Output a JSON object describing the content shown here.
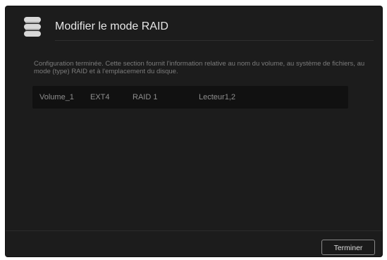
{
  "dialog": {
    "title": "Modifier le mode RAID",
    "title_icon": "database-icon",
    "description": "Configuration terminée. Cette section fournit l'information relative au nom du volume, au système de fichiers, au mode (type) RAID et à l'emplacement du disque."
  },
  "volume": {
    "name": "Volume_1",
    "filesystem": "EXT4",
    "raid_mode": "RAID 1",
    "location": "Lecteur1,2"
  },
  "footer": {
    "finish_label": "Terminer"
  },
  "colors": {
    "background": "#1c1c1c",
    "row_background": "#111111",
    "title_text": "#e6e6e6",
    "muted_text": "#7c7c7c"
  }
}
